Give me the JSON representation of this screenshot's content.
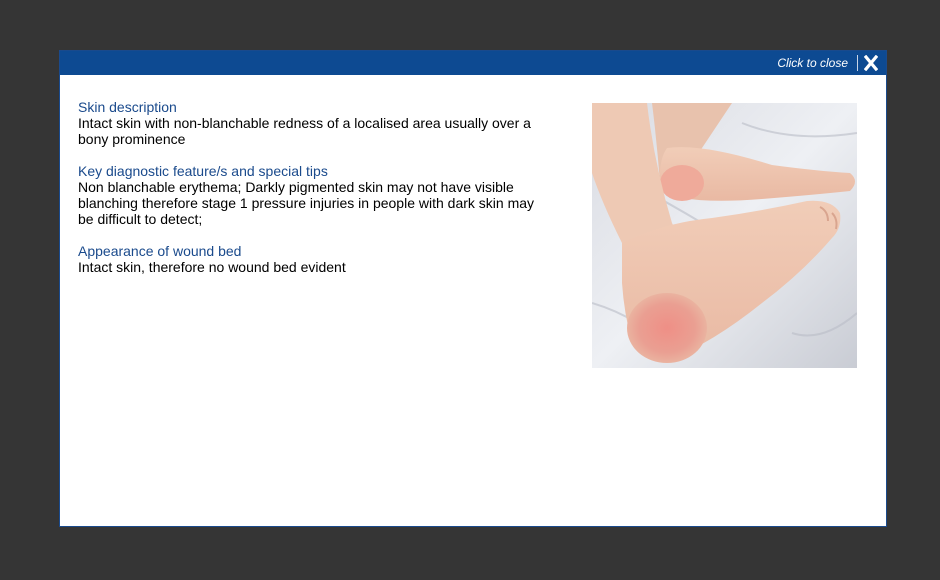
{
  "modal": {
    "close_label": "Click to close",
    "close_icon": "close-x-icon",
    "header_color": "#0d4a92",
    "heading_color": "#1a4a8c"
  },
  "sections": [
    {
      "heading": "Skin description",
      "body": "Intact skin with non-blanchable redness of a localised area usually over a bony prominence"
    },
    {
      "heading": "Key diagnostic feature/s and special tips",
      "body": "Non blanchable erythema; Darkly pigmented skin may not have visible blanching therefore stage 1 pressure injuries in people with dark skin may be difficult to detect;"
    },
    {
      "heading": "Appearance of wound bed",
      "body": "Intact skin, therefore no wound bed evident"
    }
  ],
  "image": {
    "subject": "feet with red heel (stage 1 pressure injury)"
  }
}
